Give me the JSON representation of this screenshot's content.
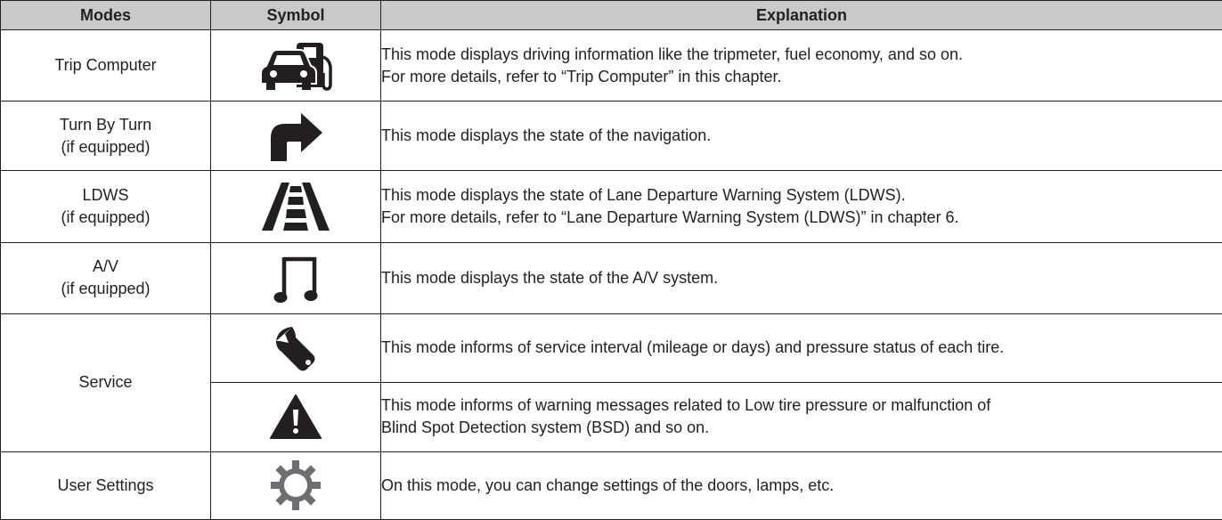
{
  "headers": {
    "modes": "Modes",
    "symbol": "Symbol",
    "explanation": "Explanation"
  },
  "rows": [
    {
      "mode": [
        "Trip Computer"
      ],
      "icon": "trip-computer-icon",
      "explanation": [
        "This mode displays driving information like the tripmeter, fuel economy, and so on.",
        "For more details, refer to “Trip Computer” in this chapter."
      ]
    },
    {
      "mode": [
        "Turn By Turn",
        "(if equipped)"
      ],
      "icon": "turn-arrow-icon",
      "explanation": [
        "This mode displays the state of the navigation."
      ]
    },
    {
      "mode": [
        "LDWS",
        "(if equipped)"
      ],
      "icon": "lane-departure-icon",
      "explanation": [
        "This mode displays the state of Lane Departure Warning System (LDWS).",
        "For more details, refer to “Lane Departure Warning System (LDWS)” in chapter 6."
      ]
    },
    {
      "mode": [
        "A/V",
        "(if equipped)"
      ],
      "icon": "music-note-icon",
      "explanation": [
        "This mode displays the state of the A/V system."
      ]
    },
    {
      "mode": [
        "Service"
      ],
      "icon": "wrench-icon",
      "explanation": [
        "This mode informs of service interval (mileage or days) and pressure status of each tire."
      ]
    },
    {
      "icon": "warning-triangle-icon",
      "explanation": [
        "This mode informs of warning messages related to Low tire pressure or malfunction of",
        "Blind Spot Detection system (BSD) and so on."
      ]
    },
    {
      "mode": [
        "User Settings"
      ],
      "icon": "gear-icon",
      "explanation": [
        "On this mode, you can change settings of the doors, lamps, etc."
      ]
    }
  ],
  "colors": {
    "header_bg": "#c8c9cb",
    "ink": "#231f20",
    "border": "#231f20"
  }
}
